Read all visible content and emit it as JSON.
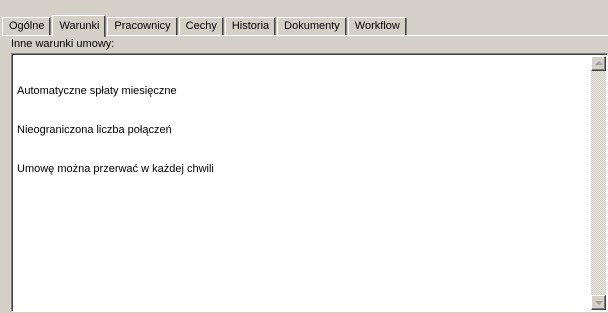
{
  "tabs": [
    {
      "label": "Ogólne",
      "active": false
    },
    {
      "label": "Warunki",
      "active": true
    },
    {
      "label": "Pracownicy",
      "active": false
    },
    {
      "label": "Cechy",
      "active": false
    },
    {
      "label": "Historia",
      "active": false
    },
    {
      "label": "Dokumenty",
      "active": false
    },
    {
      "label": "Workflow",
      "active": false
    }
  ],
  "panel": {
    "label": "Inne warunki umowy:",
    "lines": [
      "Automatyczne spłaty miesięczne",
      "Nieograniczona liczba połączeń",
      "Umowę można przerwać w każdej chwili"
    ]
  },
  "scrollbar": {
    "up_icon": "scroll-up-arrow-icon",
    "down_icon": "scroll-down-arrow-icon",
    "enabled": false
  }
}
